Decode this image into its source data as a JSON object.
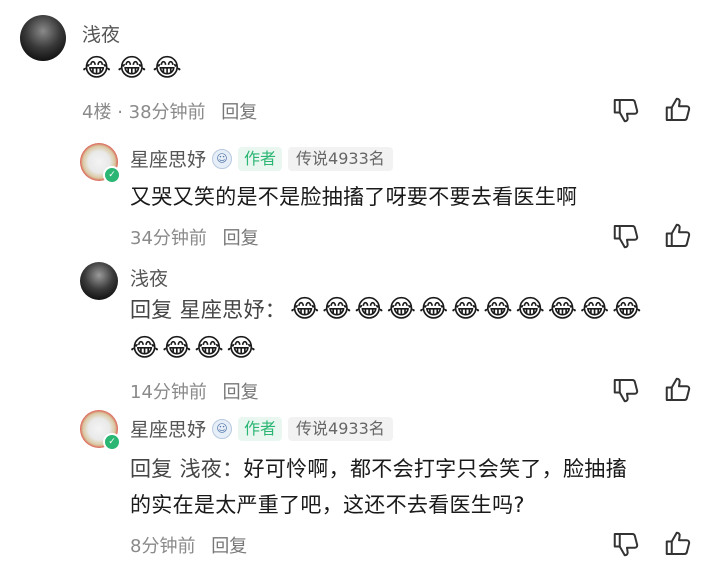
{
  "comments": [
    {
      "author": "浅夜",
      "emojis": [
        "😂",
        "😂",
        "😂"
      ],
      "floor": "4楼",
      "dot": "·",
      "time": "38分钟前",
      "reply_label": "回复"
    }
  ],
  "replies": [
    {
      "author": "星座思妤",
      "author_tag": "作者",
      "rank": "传说4933名",
      "text": "又哭又笑的是不是脸抽搐了呀要不要去看医生啊",
      "time": "34分钟前",
      "reply_label": "回复"
    },
    {
      "author": "浅夜",
      "reply_prefix": "回复 星座思妤：",
      "emojis_line1": [
        "😂",
        "😂",
        "😂",
        "😂",
        "😂",
        "😂",
        "😂",
        "😂",
        "😂",
        "😂",
        "😂"
      ],
      "emojis_line2": [
        "😂",
        "😂",
        "😂",
        "😂"
      ],
      "time": "14分钟前",
      "reply_label": "回复"
    },
    {
      "author": "星座思妤",
      "author_tag": "作者",
      "rank": "传说4933名",
      "reply_prefix": "回复 浅夜：",
      "text_line1": "好可怜啊，都不会打字只会笑了，脸抽搐",
      "text_line2": "的实在是太严重了吧，这还不去看医生吗?",
      "time": "8分钟前",
      "reply_label": "回复"
    }
  ],
  "icons": {
    "dislike": "thumbs-down-icon",
    "like": "thumbs-up-icon",
    "verified": "verified-badge-icon",
    "medal": "rank-medal-icon"
  },
  "colors": {
    "author_tag": "#2bb673",
    "meta": "#8a8a8a",
    "text": "#1a1a1a"
  }
}
